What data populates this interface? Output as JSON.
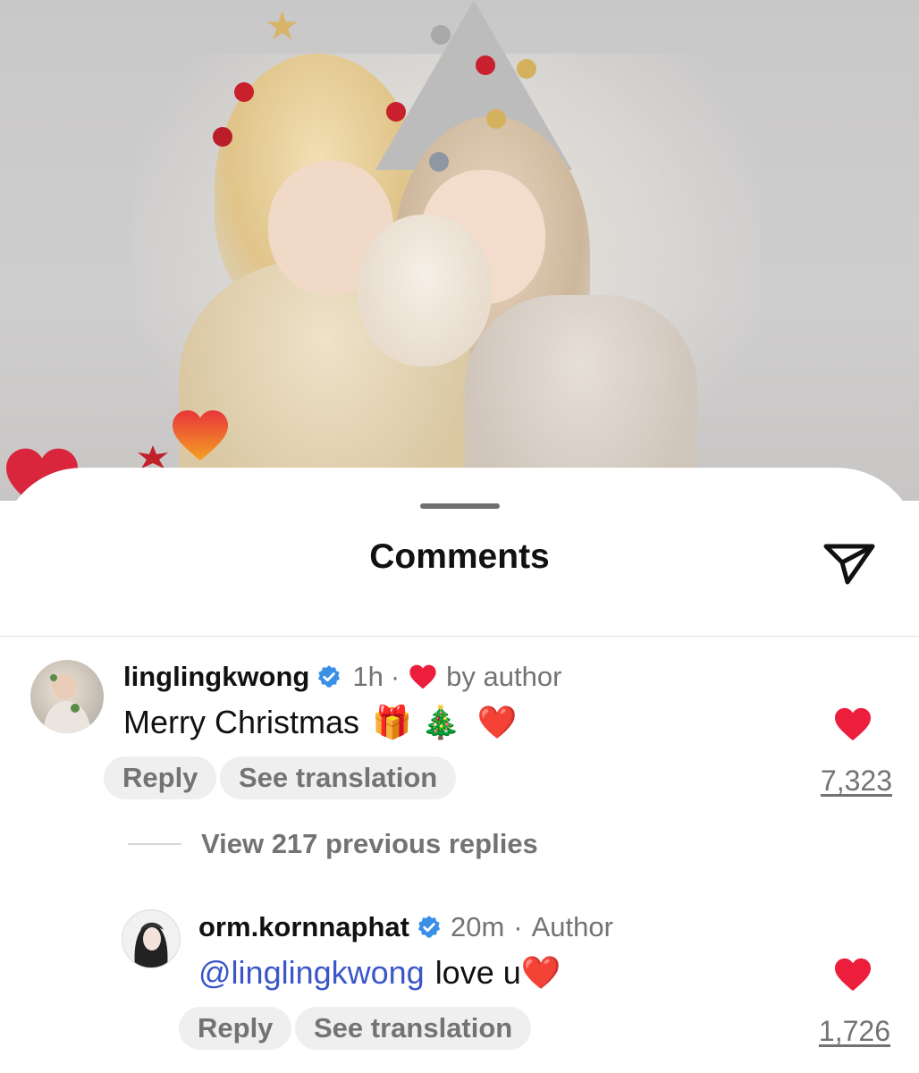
{
  "colors": {
    "like_red": "#ed1d3c",
    "mention_blue": "#3b56c9",
    "verified_blue": "#3a8fe6",
    "secondary_text": "#737373"
  },
  "photo": {
    "description_icon": "christmas-photo",
    "floating_icons": [
      "heart-icon",
      "heart-icon"
    ]
  },
  "sheet": {
    "title": "Comments",
    "send_icon": "send-icon"
  },
  "comments": [
    {
      "username": "linglingkwong",
      "verified": true,
      "time": "1h",
      "separator": "·",
      "liked_by": "by author",
      "text": "Merry Christmas",
      "emojis": [
        "🎁",
        "🎄",
        "❤️"
      ],
      "actions": {
        "reply": "Reply",
        "translate": "See translation"
      },
      "like_count": "7,323",
      "liked": true
    },
    {
      "username": "orm.kornnaphat",
      "verified": true,
      "time": "20m",
      "separator": "·",
      "badge": "Author",
      "mention": "@linglingkwong",
      "text": "love u",
      "emojis": [
        "❤️"
      ],
      "actions": {
        "reply": "Reply",
        "translate": "See translation"
      },
      "like_count": "1,726",
      "liked": true
    }
  ],
  "replies_toggle": "View 217 previous replies"
}
